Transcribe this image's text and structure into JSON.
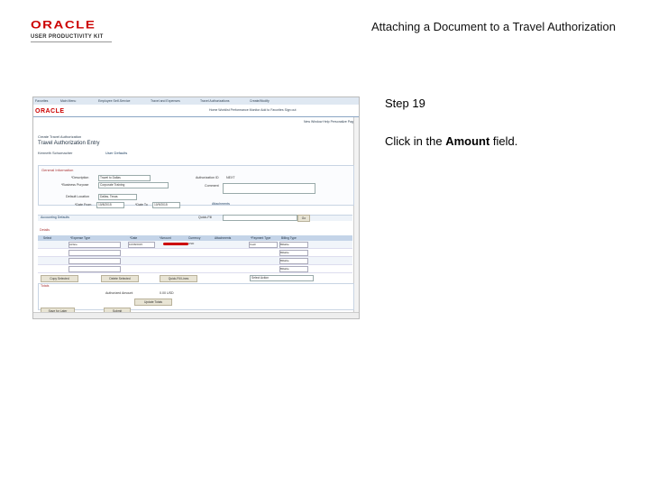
{
  "header": {
    "logo_text": "ORACLE",
    "logo_sub": "USER PRODUCTIVITY KIT",
    "title": "Attaching a Document to a Travel Authorization"
  },
  "step": {
    "label": "Step 19",
    "instruction_before": "Click in the ",
    "instruction_bold": "Amount",
    "instruction_after": " field."
  },
  "screenshot": {
    "nav": [
      "Favorites",
      "Main Menu",
      "Employee Self-Service",
      "Travel and Expenses",
      "Travel Authorizations",
      "Create/Modify"
    ],
    "logo": "ORACLE",
    "menu": "Home   Worklist   Performance Monitor   Add to Favorites   Sign out",
    "util": "New Window   Help   Personalize Page",
    "breadcrumb": "Create Travel Authorization",
    "page_title": "Travel Authorization Entry",
    "employee_name": "Kenneth Schumacher",
    "user_defaults": "User Defaults",
    "section_title": "General Information",
    "labels": {
      "description": "*Description",
      "business_purpose": "*Business Purpose",
      "default_location": "Default Location",
      "date_from": "*Date From",
      "date_to": "*Date To",
      "auth_id": "Authorization ID",
      "comment": "Comment",
      "attachments": "Attachments",
      "accounting": "Accounting Defaults",
      "quick_fill": "Quick-Fill",
      "details": "Details"
    },
    "values": {
      "description": "Travel to Dallas",
      "business_purpose": "Corporate Training",
      "auth_id": "NEXT",
      "default_location": "Dallas, Texas",
      "date_from": "10/8/2015",
      "date_to": "10/9/2015"
    },
    "grid_headers": [
      "Select",
      "*Expense Type",
      "*Date",
      "*Amount",
      "Currency",
      "Attachments",
      "*Payment Type",
      "Billing Type"
    ],
    "rows": [
      {
        "expense_type": "Airfare",
        "date": "10/08/2015",
        "currency": "USD",
        "payment": "Cash",
        "billing": "Billable"
      },
      {
        "expense_type": "",
        "date": "",
        "currency": "",
        "payment": "",
        "billing": "Billable"
      },
      {
        "expense_type": "",
        "date": "",
        "currency": "",
        "payment": "",
        "billing": "Billable"
      },
      {
        "expense_type": "",
        "date": "",
        "currency": "",
        "payment": "",
        "billing": "Billable"
      }
    ],
    "buttons": {
      "copy": "Copy Selected",
      "delete": "Delete Selected",
      "quick_fill": "Quick-Fill Lines",
      "go": "Go",
      "update": "Update Totals",
      "save": "Save for Later",
      "submit": "Submit"
    },
    "totals_label": "Totals",
    "authorized_amount_label": "Authorized Amount",
    "authorized_amount_value": "0.00  USD",
    "action_select": "Select Action"
  }
}
